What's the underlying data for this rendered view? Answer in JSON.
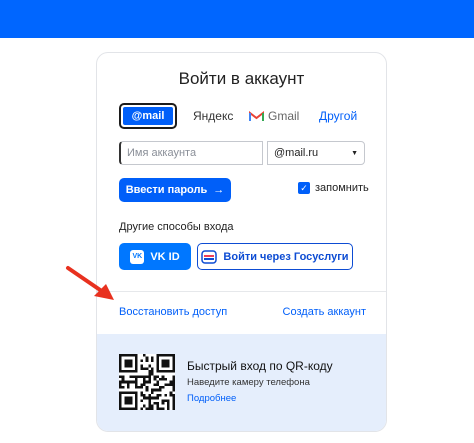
{
  "header": {
    "bg_color": "#0066ff"
  },
  "login": {
    "title": "Войти в аккаунт",
    "providers": {
      "mail": "mail",
      "yandex": "Яндекс",
      "gmail": "Gmail",
      "other": "Другой"
    },
    "account_input": {
      "placeholder": "Имя аккаунта",
      "value": ""
    },
    "domain_select": {
      "selected": "@mail.ru"
    },
    "password_button": "Ввести пароль",
    "remember": {
      "label": "запомнить",
      "checked": true
    },
    "other_methods_label": "Другие способы входа",
    "vk_button": "VK ID",
    "gosuslugi_button": "Войти через Госуслуги",
    "restore_link": "Восстановить доступ",
    "create_link": "Создать аккаунт"
  },
  "qr": {
    "title": "Быстрый вход по QR-коду",
    "subtitle": "Наведите камеру телефона",
    "more_link": "Подробнее"
  },
  "colors": {
    "accent": "#005ff9",
    "arrow": "#e8311f",
    "qr_bg": "#e5eefc"
  },
  "icons": [
    "at-icon",
    "yandex-icon",
    "gmail-icon",
    "chevron-down-icon",
    "arrow-right-icon",
    "check-icon",
    "vk-icon",
    "gosuslugi-icon",
    "qr-code-icon",
    "pointer-arrow"
  ]
}
